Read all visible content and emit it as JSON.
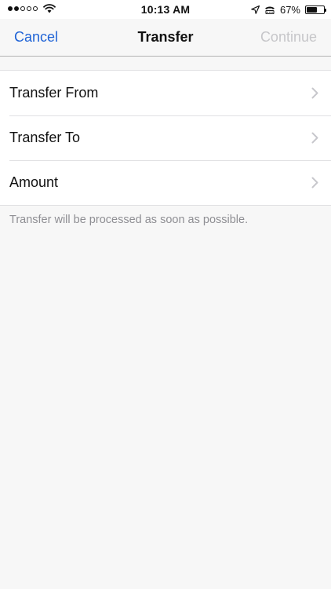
{
  "status_bar": {
    "time": "10:13 AM",
    "battery_percent": "67%",
    "battery_level": 0.67,
    "signal_bars": [
      true,
      true,
      false,
      false,
      false
    ],
    "icons": [
      "signal-dots-icon",
      "wifi-icon",
      "location-arrow-icon",
      "tty-icon",
      "battery-icon"
    ]
  },
  "nav": {
    "cancel_label": "Cancel",
    "title": "Transfer",
    "continue_label": "Continue",
    "accent_color": "#1f63d6",
    "disabled_color": "#c6c6c9"
  },
  "rows": [
    {
      "label": "Transfer From",
      "icon": "chevron-right-icon"
    },
    {
      "label": "Transfer To",
      "icon": "chevron-right-icon"
    },
    {
      "label": "Amount",
      "icon": "chevron-right-icon"
    }
  ],
  "footnote": "Transfer will be processed as soon as possible."
}
